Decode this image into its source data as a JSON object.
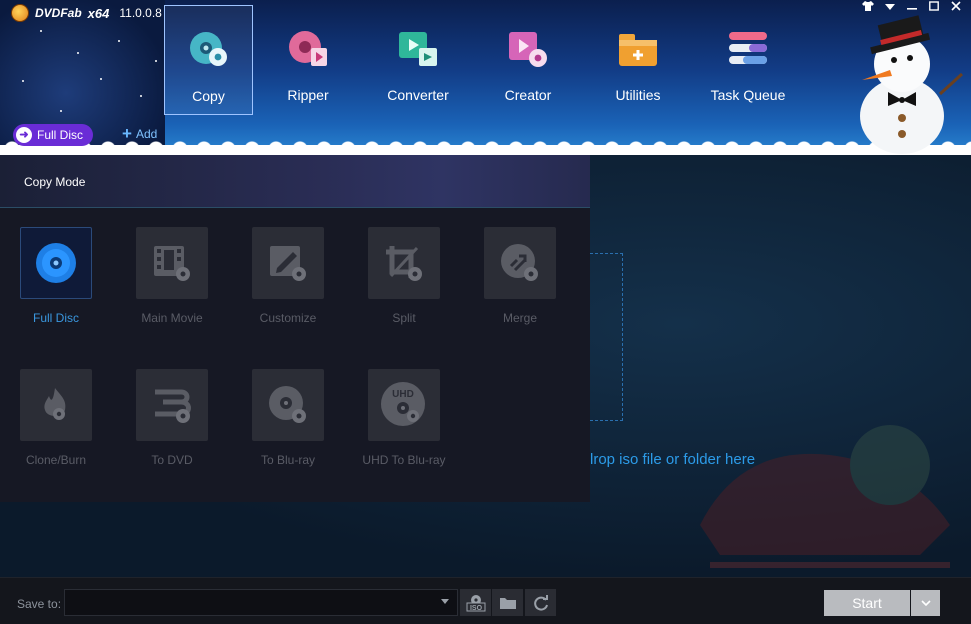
{
  "app": {
    "name": "DVDFab",
    "arch": "x64",
    "version": "11.0.0.8"
  },
  "modules": [
    {
      "label": "Copy",
      "icon": "copy-disc-icon",
      "active": true
    },
    {
      "label": "Ripper",
      "icon": "ripper-icon",
      "active": false
    },
    {
      "label": "Converter",
      "icon": "converter-icon",
      "active": false
    },
    {
      "label": "Creator",
      "icon": "creator-icon",
      "active": false
    },
    {
      "label": "Utilities",
      "icon": "utilities-toolbox-icon",
      "active": false
    },
    {
      "label": "Task Queue",
      "icon": "task-queue-icon",
      "active": false
    }
  ],
  "subbar": {
    "current_mode": "Full Disc",
    "add_label": "Add"
  },
  "copy_panel": {
    "title": "Copy Mode",
    "modes": [
      {
        "label": "Full Disc",
        "icon": "full-disc-icon",
        "selected": true
      },
      {
        "label": "Main Movie",
        "icon": "main-movie-icon",
        "selected": false
      },
      {
        "label": "Customize",
        "icon": "customize-icon",
        "selected": false
      },
      {
        "label": "Split",
        "icon": "split-icon",
        "selected": false
      },
      {
        "label": "Merge",
        "icon": "merge-icon",
        "selected": false
      },
      {
        "label": "Clone/Burn",
        "icon": "clone-burn-icon",
        "selected": false
      },
      {
        "label": "To DVD",
        "icon": "to-dvd-icon",
        "selected": false
      },
      {
        "label": "To Blu-ray",
        "icon": "to-bluray-icon",
        "selected": false
      },
      {
        "label": "UHD To Blu-ray",
        "icon": "uhd-to-bluray-icon",
        "selected": false
      }
    ]
  },
  "main": {
    "drop_hint": "lrop iso file or folder here"
  },
  "bottom": {
    "save_label": "Save to:",
    "save_value": "",
    "start_label": "Start"
  },
  "colors": {
    "accent": "#3a97df",
    "pill": "#6a2cd6",
    "header_top": "#0b1f4e",
    "header_bottom": "#2a86d2"
  }
}
